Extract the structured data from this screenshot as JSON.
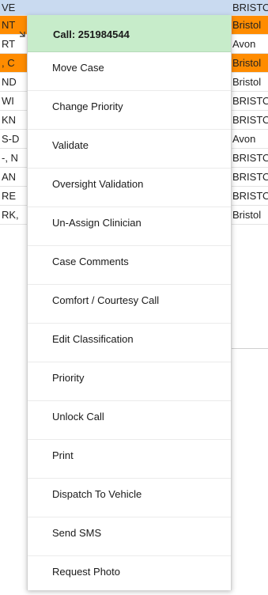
{
  "grid": {
    "rows": [
      {
        "left": "VE",
        "right": "BRISTO",
        "style": "header"
      },
      {
        "left": "NT",
        "right": "Bristol",
        "style": "highlight"
      },
      {
        "left": "RT",
        "right": "Avon",
        "style": "normal"
      },
      {
        "left": ", C",
        "right": "Bristol",
        "style": "highlight"
      },
      {
        "left": "ND",
        "right": "Bristol",
        "style": "normal"
      },
      {
        "left": "WI",
        "right": "BRISTO",
        "style": "normal"
      },
      {
        "left": "KN",
        "right": "BRISTO",
        "style": "normal"
      },
      {
        "left": "S-D",
        "right": "Avon",
        "style": "normal"
      },
      {
        "left": "-, N",
        "right": "BRISTO",
        "style": "normal"
      },
      {
        "left": "AN",
        "right": "BRISTO",
        "style": "normal"
      },
      {
        "left": "RE",
        "right": "BRISTO",
        "style": "normal"
      },
      {
        "left": "RK,",
        "right": "Bristol",
        "style": "normal"
      }
    ]
  },
  "context_menu": {
    "title": "Call: 251984544",
    "items": [
      {
        "label": "Move Case"
      },
      {
        "label": "Change Priority"
      },
      {
        "label": "Validate"
      },
      {
        "label": "Oversight Validation"
      },
      {
        "label": "Un-Assign Clinician"
      },
      {
        "label": "Case Comments"
      },
      {
        "label": "Comfort / Courtesy Call"
      },
      {
        "label": "Edit Classification"
      },
      {
        "label": "Priority"
      },
      {
        "label": "Unlock Call"
      },
      {
        "label": "Print"
      },
      {
        "label": "Dispatch To Vehicle"
      },
      {
        "label": "Send SMS"
      },
      {
        "label": "Request Photo"
      }
    ]
  },
  "colors": {
    "header_row": "#c9daf0",
    "highlight_row": "#ff8c00",
    "menu_header": "#c7ecca"
  },
  "icons": {
    "resize_handle": "resize-handle-icon"
  }
}
